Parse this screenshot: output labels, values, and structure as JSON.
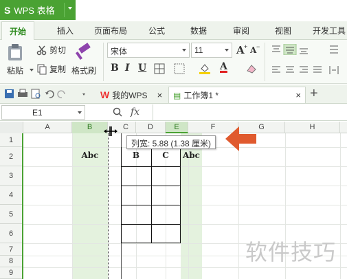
{
  "app": {
    "title": "WPS 表格",
    "accent": "#4aa233"
  },
  "ribbon_tabs": [
    "开始",
    "插入",
    "页面布局",
    "公式",
    "数据",
    "审阅",
    "视图",
    "开发工具"
  ],
  "clipboard": {
    "paste": "粘贴",
    "cut": "剪切",
    "copy": "复制",
    "format_painter": "格式刷"
  },
  "font": {
    "family": "宋体",
    "size": "11",
    "bold": "B",
    "italic": "I",
    "underline": "U",
    "grow": "A",
    "shrink": "A",
    "color_a": "A"
  },
  "doc_tabs": [
    {
      "label": "我的WPS",
      "close": "×"
    },
    {
      "label": "工作簿1 *",
      "close": "×"
    }
  ],
  "new_tab": "+",
  "formula_bar": {
    "cell_ref": "E1",
    "fx": "fx",
    "zoom_icon": "magnifier-icon"
  },
  "columns": [
    "A",
    "B",
    "C",
    "D",
    "E",
    "F",
    "G",
    "H"
  ],
  "rows": [
    "1",
    "2",
    "3",
    "4",
    "5",
    "6",
    "7",
    "8",
    "9"
  ],
  "cells": {
    "B2": "Abc",
    "D2": "B",
    "E2": "C",
    "F2": "Abc"
  },
  "tooltip": "列宽: 5.88 (1.38 厘米)",
  "watermark": "软件技巧",
  "colors": {
    "selection": "#cfe6c6",
    "arrow": "#e05a2e"
  }
}
